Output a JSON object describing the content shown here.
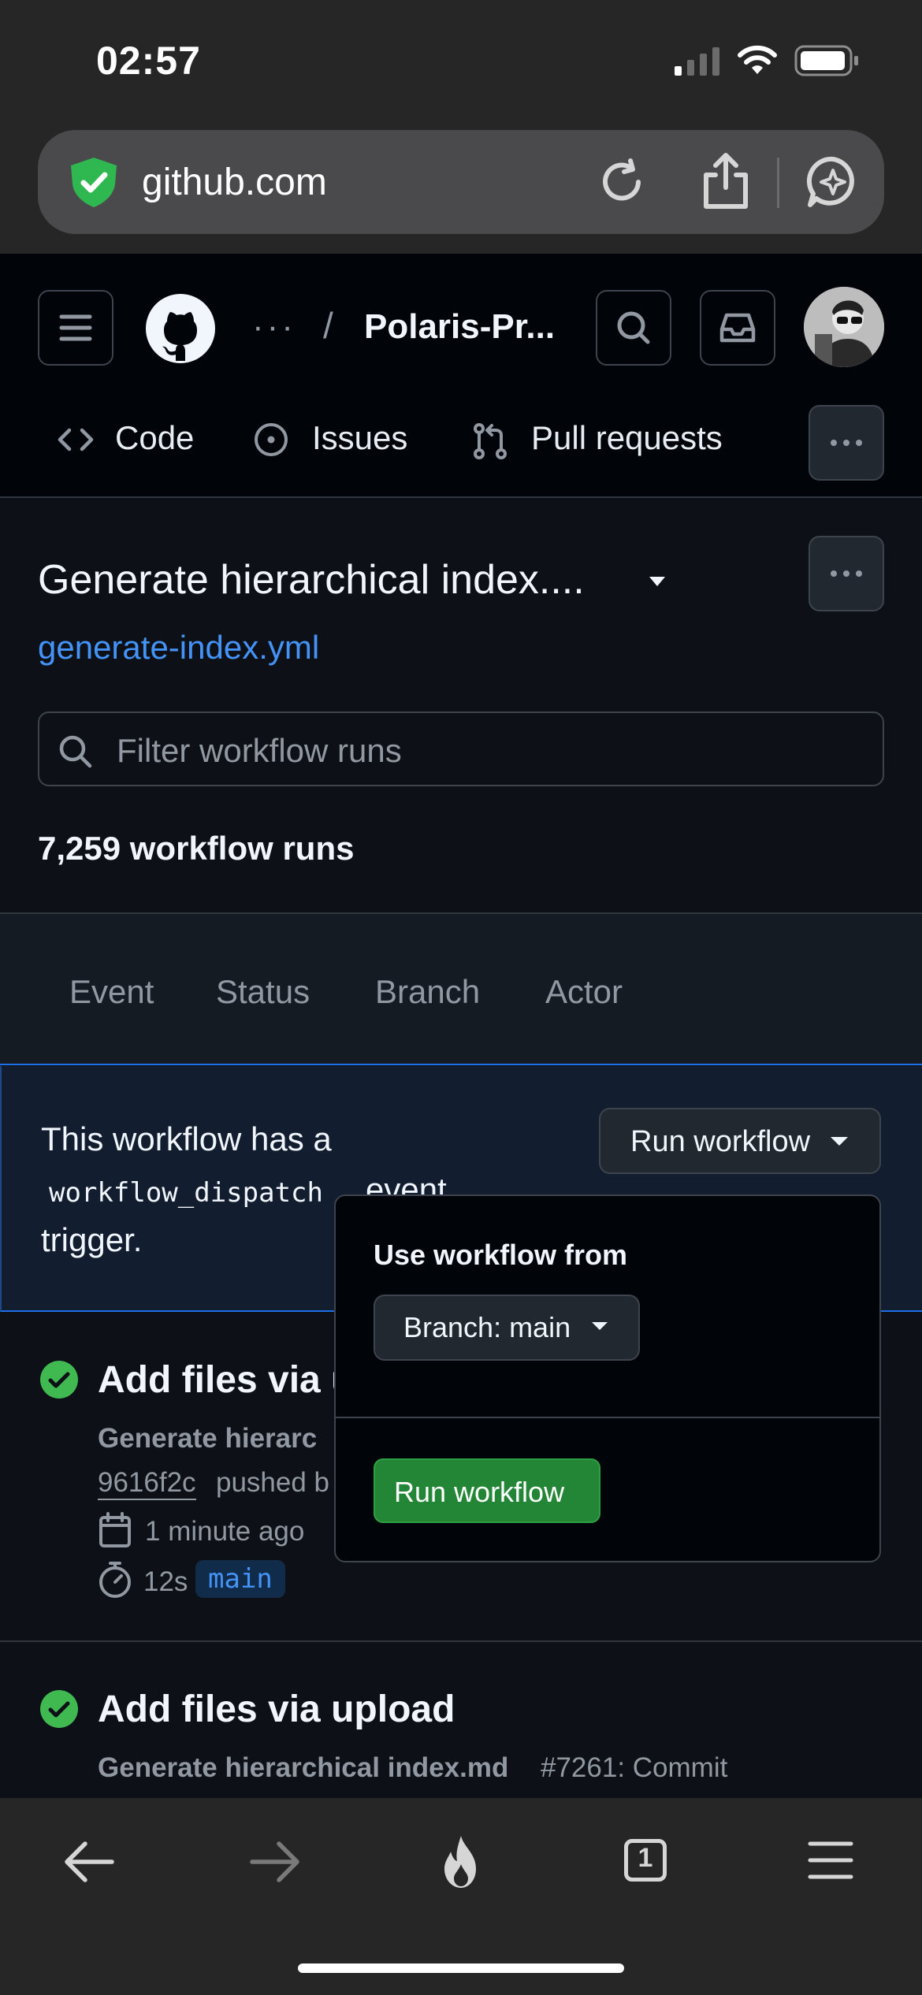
{
  "status_bar": {
    "time": "02:57"
  },
  "browser": {
    "url": "github.com",
    "tab_count": "1"
  },
  "header": {
    "owner_ellipsis": "···",
    "separator": "/",
    "repo_name": "Polaris-Pr...",
    "nav": [
      {
        "label": "Code"
      },
      {
        "label": "Issues"
      },
      {
        "label": "Pull requests"
      }
    ]
  },
  "workflow": {
    "title": "Generate hierarchical index....",
    "file": "generate-index.yml",
    "filter_placeholder": "Filter workflow runs",
    "run_count": "7,259 workflow runs",
    "filters": [
      "Event",
      "Status",
      "Branch",
      "Actor"
    ]
  },
  "banner": {
    "line1": "This workflow has a",
    "code": "workflow_dispatch",
    "line2_rest": "event",
    "line3": "trigger.",
    "run_button": "Run workflow"
  },
  "popover": {
    "heading": "Use workflow from",
    "branch_button": "Branch: main",
    "run_button": "Run workflow"
  },
  "runs": [
    {
      "title": "Add files via u",
      "workflow_name": "Generate hierarc",
      "commit": "9616f2c",
      "pushed_text": "pushed b",
      "time_ago": "1 minute ago",
      "duration": "12s",
      "branch": "main"
    },
    {
      "title": "Add files via upload",
      "workflow_name": "Generate hierarchical index.md",
      "run_info": "#7261: Commit"
    }
  ],
  "colors": {
    "bg": "#0d1117",
    "accent": "#4493f8",
    "success": "#3fb950",
    "button_green": "#238636"
  }
}
